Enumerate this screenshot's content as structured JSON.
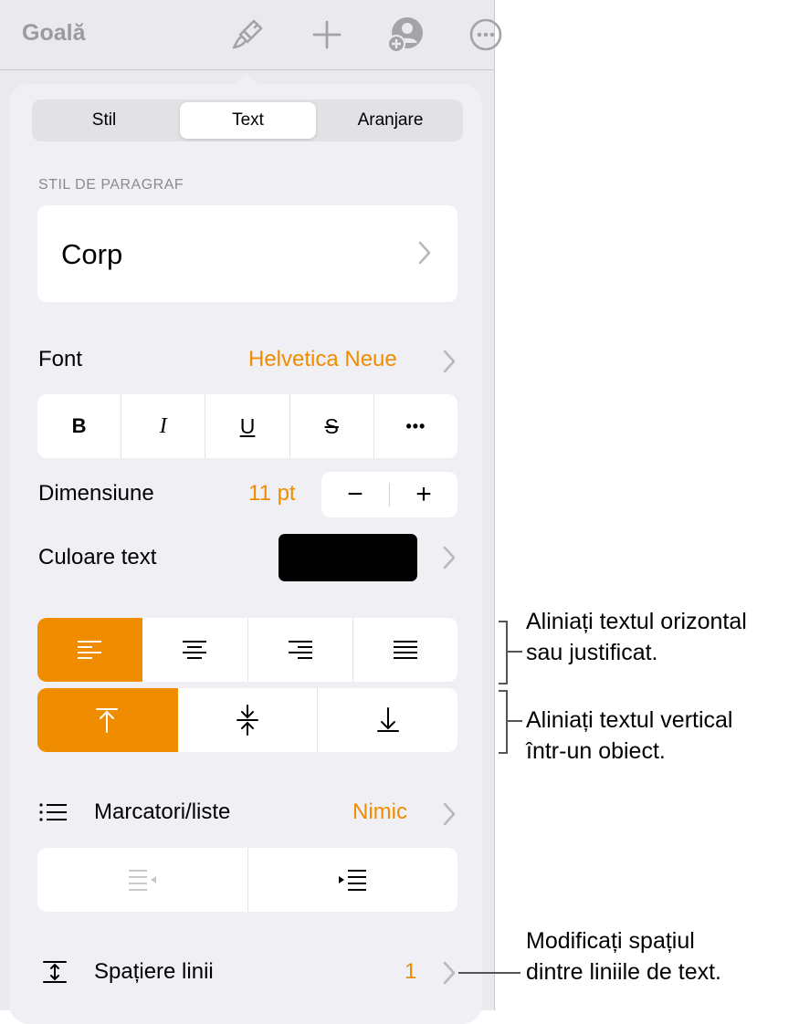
{
  "toolbar": {
    "doc_title": "Goală",
    "icons": [
      "paintbrush-icon",
      "plus-icon",
      "collaborate-icon",
      "more-icon"
    ]
  },
  "tabs": [
    {
      "label": "Stil",
      "active": false
    },
    {
      "label": "Text",
      "active": true
    },
    {
      "label": "Aranjare",
      "active": false
    }
  ],
  "paragraph_style": {
    "section_label": "STIL DE PARAGRAF",
    "value": "Corp"
  },
  "font": {
    "label": "Font",
    "value": "Helvetica Neue",
    "styles": [
      "B",
      "I",
      "U",
      "S",
      "•••"
    ]
  },
  "size": {
    "label": "Dimensiune",
    "value": "11 pt",
    "minus": "−",
    "plus": "+"
  },
  "text_color": {
    "label": "Culoare text",
    "swatch": "#000000"
  },
  "horizontal_align": {
    "options": [
      "left",
      "center",
      "right",
      "justify"
    ],
    "selected": "left"
  },
  "vertical_align": {
    "options": [
      "top",
      "middle",
      "bottom"
    ],
    "selected": "top"
  },
  "bullets": {
    "label": "Marcatori/liste",
    "value": "Nimic"
  },
  "line_spacing": {
    "label": "Spațiere linii",
    "value": "1"
  },
  "callouts": {
    "horizontal_line1": "Aliniați textul orizontal",
    "horizontal_line2": "sau justificat.",
    "vertical_line1": "Aliniați textul vertical",
    "vertical_line2": "într-un obiect.",
    "spacing_line1": "Modificați spațiul",
    "spacing_line2": "dintre liniile de text."
  },
  "colors": {
    "accent": "#f08c00",
    "panel_bg": "#efeff4",
    "toolbar_icon": "#a3a3a8"
  }
}
